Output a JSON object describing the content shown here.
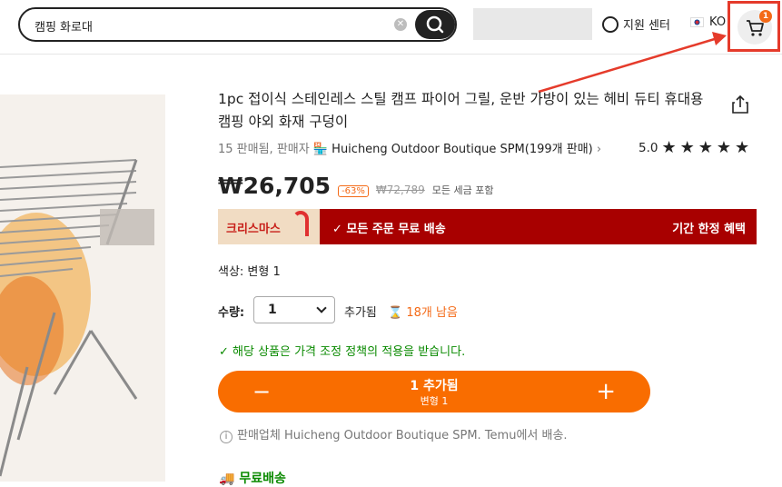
{
  "header": {
    "search_value": "캠핑 화로대",
    "support_label": "지원 센터",
    "lang_label": "KO",
    "cart_count": "1"
  },
  "product": {
    "title": "1pc 접이식 스테인레스 스틸 캠프 파이어 그릴, 운반 가방이 있는 헤비 듀티 휴대용 캠핑 야외 화재 구덩이",
    "sold_count": "15 판매됨, 판매자",
    "seller_name": "Huicheng Outdoor Boutique SPM(199개 판매)",
    "rating": "5.0",
    "rating_stars": 5,
    "price": "₩26,705",
    "discount": "-63%",
    "old_price": "₩72,789",
    "tax_note": "모든 세금 포함"
  },
  "promo": {
    "badge": "크리스마스",
    "main": "모든 주문 무료 배송",
    "right": "기간 한정 혜택"
  },
  "options": {
    "color_label": "색상: 변형 1",
    "qty_label": "수량:",
    "qty_value": "1",
    "added_label": "추가됨",
    "stock_label": "18개 남음"
  },
  "policy_note": "해당 상품은 가격 조정 정책의 적용을 받습니다.",
  "cta": {
    "main": "1 추가됨",
    "sub": "변형 1",
    "minus": "−",
    "plus": "+"
  },
  "info_text": "판매업체 Huicheng Outdoor Boutique SPM. Temu에서 배송.",
  "shipping_label": "무료배송",
  "colors": {
    "accent": "#f96d00",
    "promo_red": "#a80000",
    "success_green": "#0a8a00",
    "highlight_red": "#e53b2b"
  }
}
